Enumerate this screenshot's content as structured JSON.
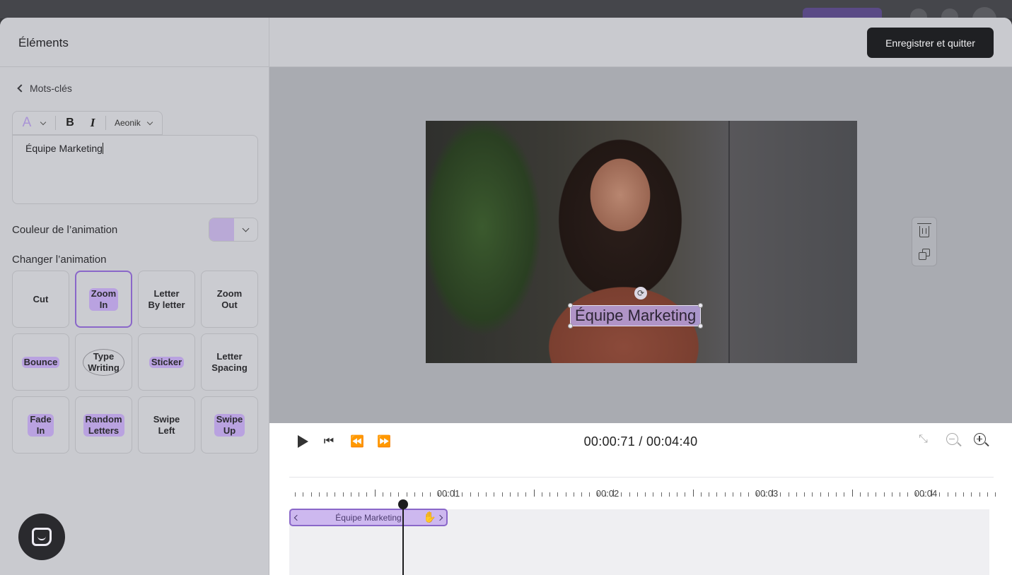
{
  "left_panel": {
    "title": "Éléments",
    "back_label": "Mots-clés",
    "font_name": "Aeonik",
    "bold_label": "B",
    "italic_label": "I",
    "text_color_icon": "A",
    "text_value": "Équipe Marketing",
    "color_label": "Couleur de l’animation",
    "animation_color": "#b9a9d6",
    "change_animation_label": "Changer l’animation",
    "animations": [
      {
        "l1": "Cut",
        "l2": ""
      },
      {
        "l1": "Zoom",
        "l2": "In"
      },
      {
        "l1": "Letter",
        "l2": "By letter"
      },
      {
        "l1": "Zoom",
        "l2": "Out"
      },
      {
        "l1": "Bounce",
        "l2": ""
      },
      {
        "l1": "Type",
        "l2": "Writing"
      },
      {
        "l1": "Sticker",
        "l2": ""
      },
      {
        "l1": "Letter",
        "l2": "Spacing"
      },
      {
        "l1": "Fade",
        "l2": "In"
      },
      {
        "l1": "Random",
        "l2": "Letters"
      },
      {
        "l1": "Swipe",
        "l2": "Left"
      },
      {
        "l1": "Swipe",
        "l2": "Up"
      }
    ],
    "selected_animation": "Zoom In"
  },
  "header": {
    "save_button": "Enregistrer et quitter"
  },
  "preview": {
    "caption": "Équipe Marketing",
    "tools": [
      "trash-icon",
      "duplicate-icon"
    ]
  },
  "player": {
    "time": "00:00:71 / 00:04:40",
    "ruler_labels": [
      "00:01",
      "00:02",
      "00:03",
      "00:04"
    ],
    "clip_label": "Équipe Marketing"
  },
  "colors": {
    "accent": "#8a67c9",
    "highlight": "#b9a2e0",
    "dark_button": "#1f2023"
  }
}
